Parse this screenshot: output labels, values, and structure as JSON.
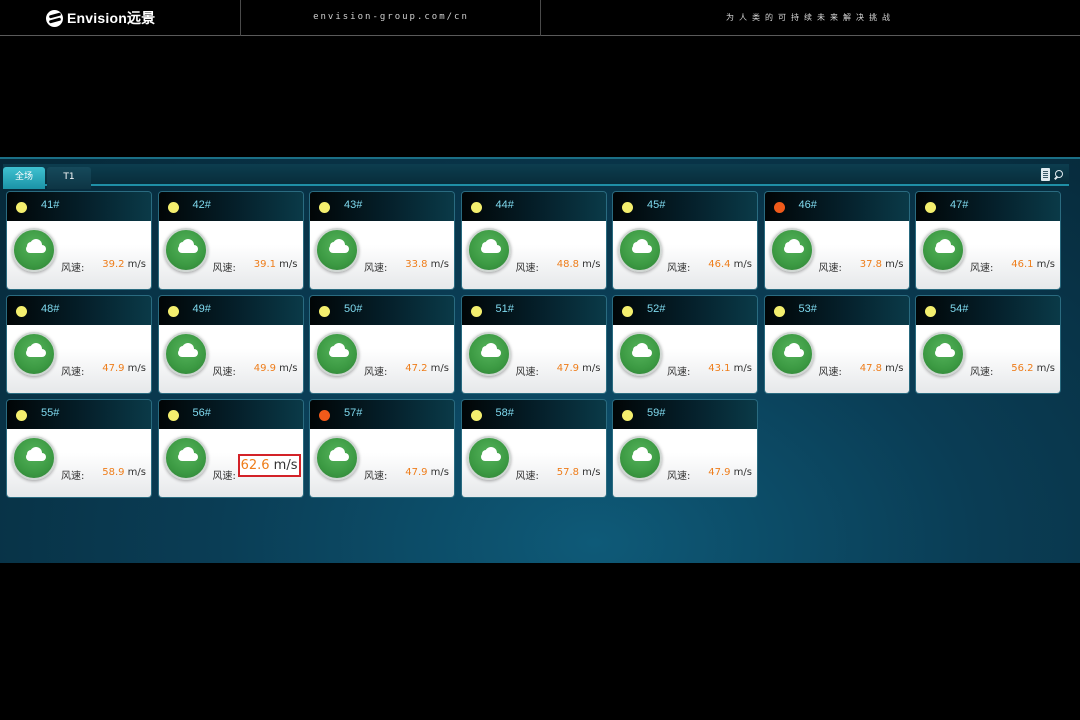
{
  "header": {
    "logo_text": "Envision远景",
    "url": "envision-group.com/cn",
    "slogan": "为人类的可持续未来解决挑战"
  },
  "tabs": [
    {
      "label": "全场",
      "active": true
    },
    {
      "label": "T1",
      "active": false
    }
  ],
  "speed_label": "风速:",
  "unit": "m/s",
  "colors": {
    "status_normal": "#f4ef6e",
    "status_alert": "#f05a1a",
    "speed_value": "#ee7d1a",
    "highlight_border": "#d32228"
  },
  "turbines": [
    {
      "id": "41#",
      "status": "normal",
      "speed": "39.2"
    },
    {
      "id": "42#",
      "status": "normal",
      "speed": "39.1"
    },
    {
      "id": "43#",
      "status": "normal",
      "speed": "33.8"
    },
    {
      "id": "44#",
      "status": "normal",
      "speed": "48.8"
    },
    {
      "id": "45#",
      "status": "normal",
      "speed": "46.4"
    },
    {
      "id": "46#",
      "status": "alert",
      "speed": "37.8"
    },
    {
      "id": "47#",
      "status": "normal",
      "speed": "46.1"
    },
    {
      "id": "48#",
      "status": "normal",
      "speed": "47.9"
    },
    {
      "id": "49#",
      "status": "normal",
      "speed": "49.9"
    },
    {
      "id": "50#",
      "status": "normal",
      "speed": "47.2"
    },
    {
      "id": "51#",
      "status": "normal",
      "speed": "47.9"
    },
    {
      "id": "52#",
      "status": "normal",
      "speed": "43.1"
    },
    {
      "id": "53#",
      "status": "normal",
      "speed": "47.8"
    },
    {
      "id": "54#",
      "status": "normal",
      "speed": "56.2"
    },
    {
      "id": "55#",
      "status": "normal",
      "speed": "58.9"
    },
    {
      "id": "56#",
      "status": "normal",
      "speed": "62.6",
      "highlighted": true
    },
    {
      "id": "57#",
      "status": "alert",
      "speed": "47.9"
    },
    {
      "id": "58#",
      "status": "normal",
      "speed": "57.8"
    },
    {
      "id": "59#",
      "status": "normal",
      "speed": "47.9"
    }
  ]
}
